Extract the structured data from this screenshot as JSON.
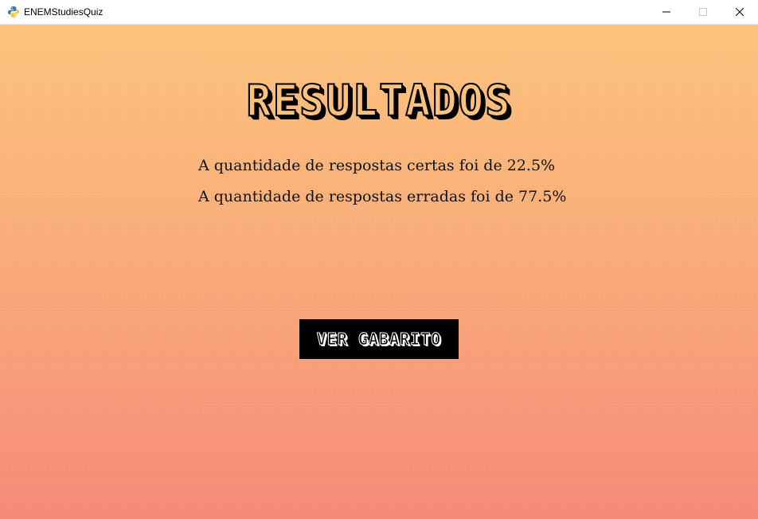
{
  "window": {
    "title": "ENEMStudiesQuiz",
    "icon": "python-icon",
    "controls": {
      "minimize_icon": "minimize-icon",
      "maximize_icon": "maximize-icon",
      "close_icon": "close-icon"
    }
  },
  "results": {
    "heading": "RESULTADOS",
    "correct_text": "A quantidade de respostas certas foi de 22.5%",
    "wrong_text": "A quantidade de respostas erradas foi de 77.5%",
    "correct_percent": 22.5,
    "wrong_percent": 77.5
  },
  "actions": {
    "view_answers_label": "VER GABARITO"
  },
  "colors": {
    "background_top": "#fdc47e",
    "background_bottom": "#f78b79",
    "heading_fill": "#fbc27c",
    "button_bg": "#000000",
    "button_text_outline": "#ffffff"
  }
}
